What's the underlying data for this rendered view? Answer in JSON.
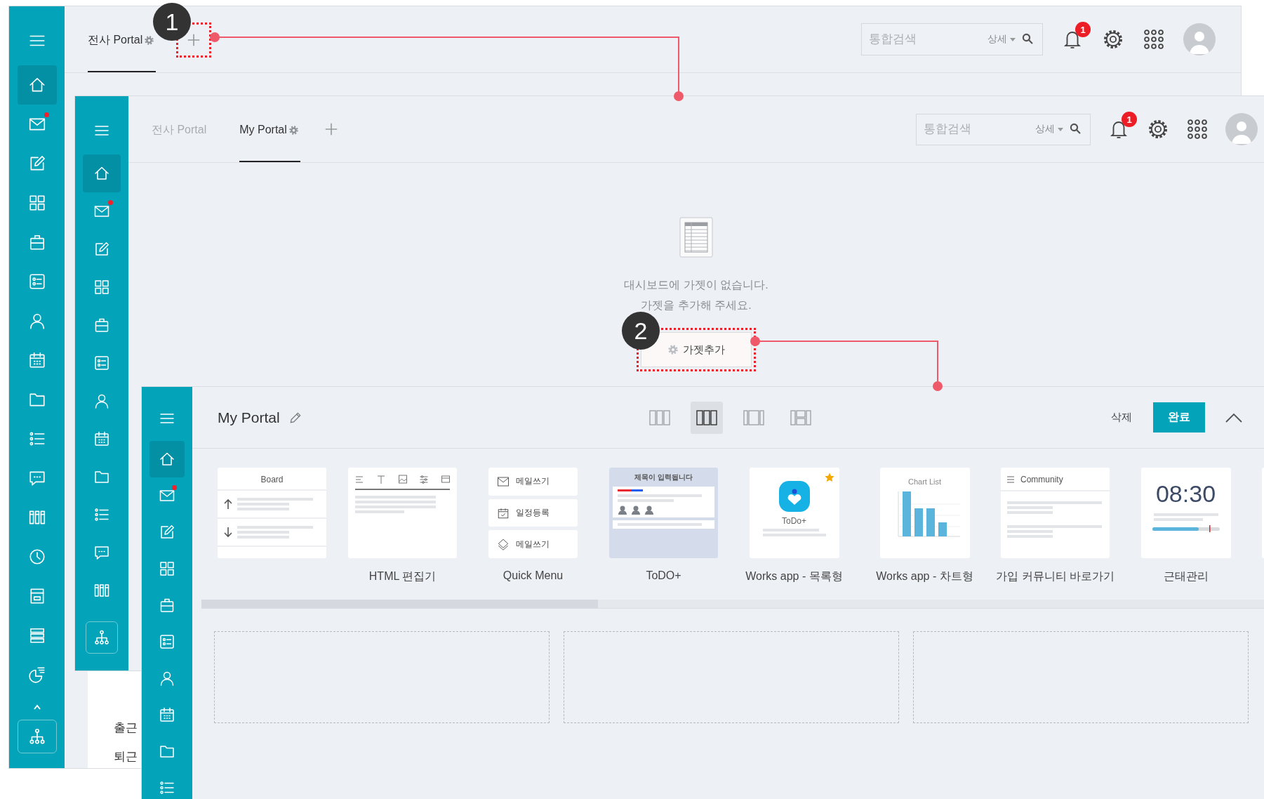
{
  "portal_screen": {
    "sidebar": {
      "items": [
        {
          "kind": "home",
          "selected": true,
          "unread": false
        },
        {
          "kind": "mail",
          "selected": false,
          "unread": true
        },
        {
          "kind": "edit",
          "selected": false,
          "unread": false
        },
        {
          "kind": "grid",
          "selected": false,
          "unread": false
        },
        {
          "kind": "briefcase",
          "selected": false,
          "unread": false
        },
        {
          "kind": "card",
          "selected": false,
          "unread": false
        },
        {
          "kind": "person",
          "selected": false,
          "unread": false
        },
        {
          "kind": "calendar",
          "selected": false,
          "unread": false
        },
        {
          "kind": "folder",
          "selected": false,
          "unread": false
        },
        {
          "kind": "list",
          "selected": false,
          "unread": false
        },
        {
          "kind": "chat",
          "selected": false,
          "unread": false
        },
        {
          "kind": "columns",
          "selected": false,
          "unread": false
        },
        {
          "kind": "clock",
          "selected": false,
          "unread": false
        },
        {
          "kind": "board",
          "selected": false,
          "unread": false
        },
        {
          "kind": "rows",
          "selected": false,
          "unread": false
        },
        {
          "kind": "pie",
          "selected": false,
          "unread": false
        }
      ]
    },
    "tabs": [
      {
        "label": "전사 Portal",
        "selected": true,
        "has_settings": true
      }
    ],
    "search": {
      "placeholder": "통합검색",
      "scope": "상세"
    },
    "notification_count": "1",
    "attendance_labels": [
      "출근",
      "퇴근"
    ]
  },
  "empty_portal_screen": {
    "sidebar": {
      "items": [
        {
          "kind": "home",
          "selected": true,
          "unread": false
        },
        {
          "kind": "mail",
          "selected": false,
          "unread": true
        },
        {
          "kind": "edit",
          "selected": false,
          "unread": false
        },
        {
          "kind": "grid",
          "selected": false,
          "unread": false
        },
        {
          "kind": "briefcase",
          "selected": false,
          "unread": false
        },
        {
          "kind": "card",
          "selected": false,
          "unread": false
        },
        {
          "kind": "person",
          "selected": false,
          "unread": false
        },
        {
          "kind": "calendar",
          "selected": false,
          "unread": false
        },
        {
          "kind": "folder",
          "selected": false,
          "unread": false
        },
        {
          "kind": "list",
          "selected": false,
          "unread": false
        },
        {
          "kind": "chat",
          "selected": false,
          "unread": false
        },
        {
          "kind": "columns",
          "selected": false,
          "unread": false
        }
      ]
    },
    "tabs": [
      {
        "label": "전사 Portal",
        "selected": false,
        "has_settings": false
      },
      {
        "label": "My Portal",
        "selected": true,
        "has_settings": true
      }
    ],
    "search": {
      "placeholder": "통합검색",
      "scope": "상세"
    },
    "notification_count": "1",
    "empty_state": {
      "message": [
        "대시보드에 가젯이 없습니다.",
        "가젯을 추가해 주세요."
      ],
      "button": "가젯추가"
    }
  },
  "edit_screen": {
    "sidebar": {
      "items": [
        {
          "kind": "home",
          "selected": true,
          "unread": false
        },
        {
          "kind": "mail",
          "selected": false,
          "unread": true
        },
        {
          "kind": "edit",
          "selected": false,
          "unread": false
        },
        {
          "kind": "grid",
          "selected": false,
          "unread": false
        },
        {
          "kind": "briefcase",
          "selected": false,
          "unread": false
        },
        {
          "kind": "card",
          "selected": false,
          "unread": false
        },
        {
          "kind": "person",
          "selected": false,
          "unread": false
        },
        {
          "kind": "calendar",
          "selected": false,
          "unread": false
        },
        {
          "kind": "folder",
          "selected": false,
          "unread": false
        },
        {
          "kind": "list",
          "selected": false,
          "unread": false
        }
      ]
    },
    "title": "My Portal",
    "layouts": [
      {
        "kind": "three-column",
        "selected": false
      },
      {
        "kind": "three-column",
        "selected": true
      },
      {
        "kind": "wide-center",
        "selected": false
      },
      {
        "kind": "split-side",
        "selected": false
      }
    ],
    "delete_label": "삭제",
    "done_label": "완료",
    "gadgets": [
      {
        "kind": "board",
        "title": "Board"
      },
      {
        "kind": "html",
        "label": "HTML 편집기"
      },
      {
        "kind": "quick-menu",
        "label": "Quick Menu",
        "items": [
          "메일쓰기",
          "일정등록",
          "메일쓰기"
        ]
      },
      {
        "kind": "todo",
        "label": "ToDO+",
        "title": "제목이 입력됩니다"
      },
      {
        "kind": "works-list",
        "label": "Works app - 목록형",
        "caption": "ToDo+"
      },
      {
        "kind": "works-chart",
        "label": "Works app - 차트형",
        "title": "Chart List"
      },
      {
        "kind": "community",
        "label": "가입 커뮤니티 바로가기",
        "title": "Community"
      },
      {
        "kind": "attendance",
        "label": "근태관리",
        "time": "08:30"
      },
      {
        "kind": "blank"
      }
    ]
  },
  "annotations": [
    {
      "number": "1"
    },
    {
      "number": "2"
    }
  ]
}
